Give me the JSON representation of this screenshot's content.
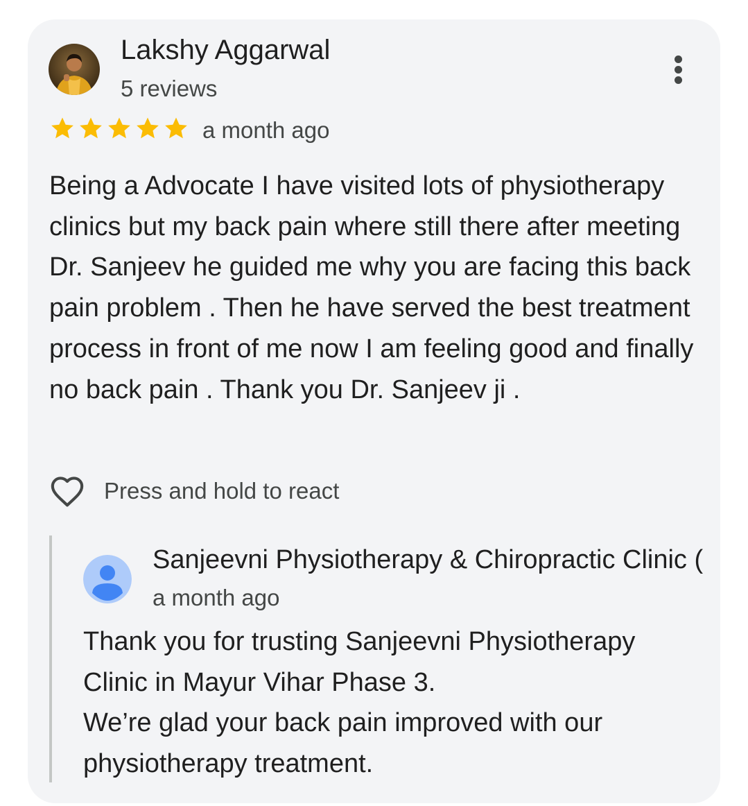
{
  "review": {
    "author_name": "Lakshy Aggarwal",
    "author_meta": "5 reviews",
    "rating": 5,
    "rating_max": 5,
    "time": "a month ago",
    "text": "Being a Advocate I have visited lots of physiotherapy clinics but my back pain where still there after meeting Dr. Sanjeev he guided me why you are facing this back pain problem . Then he have served the best treatment process in front of me now I am feeling good and finally no back pain . Thank you Dr. Sanjeev ji .",
    "react_label": "Press and hold to react"
  },
  "owner_reply": {
    "name": "Sanjeevni Physiotherapy & Chiropractic Clinic (",
    "time": "a month ago",
    "lines": [
      "Thank you for trusting Sanjeevni Physiotherapy",
      "Clinic in Mayur Vihar Phase 3.",
      "We’re glad your back pain improved with our",
      "physiotherapy treatment."
    ]
  },
  "icons": {
    "more": "more-vert-icon",
    "star": "star-icon",
    "react": "heart-outline-icon",
    "owner_avatar": "person-icon"
  },
  "colors": {
    "card_background": "#f3f4f6",
    "star": "#fbbc04",
    "owner_avatar_bg": "#aecbfa",
    "owner_avatar_fg": "#4285f4",
    "primary_text": "#1f1f1f",
    "secondary_text": "#444746"
  }
}
